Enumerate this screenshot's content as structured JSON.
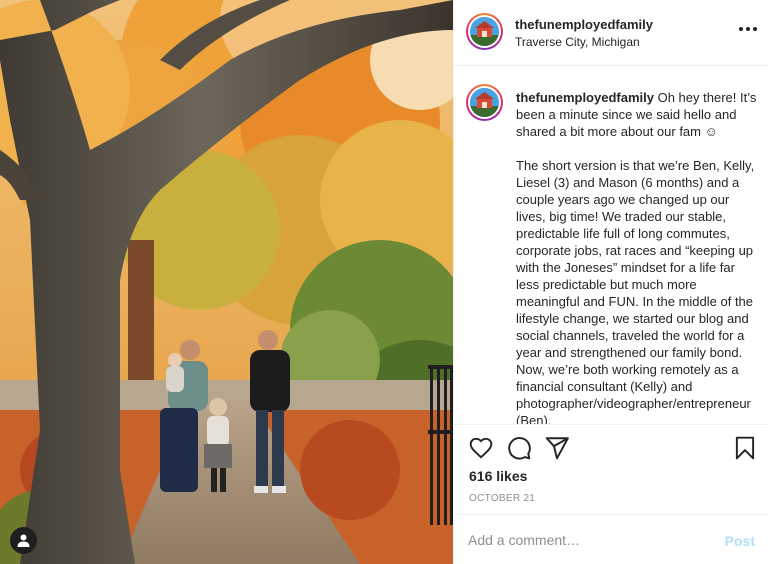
{
  "post": {
    "username": "thefunemployedfamily",
    "location": "Traverse City, Michigan",
    "caption_paragraphs": [
      "Oh hey there! It’s been a minute since we said hello and shared a bit more about our fam ☺",
      "The short version is that we’re Ben, Kelly, Liesel (3) and Mason (6 months) and a couple years ago we changed up our lives, big time! We traded our stable, predictable life full of long commutes, corporate jobs, rat races and “keeping up with the Joneses” mindset for a life far less predictable but much more meaningful and FUN. In the middle of the lifestyle change, we started our blog and social channels, traveled the world for a year and strengthened our family bond. Now, we’re both working remotely as a financial consultant (Kelly) and photographer/videographer/entrepreneur (Ben)."
    ],
    "likes": "616 likes",
    "date": "OCTOBER 21"
  },
  "comment_box": {
    "placeholder": "Add a comment…",
    "post_label": "Post"
  },
  "icons": {
    "more": "more-options-icon",
    "like": "heart-icon",
    "comment": "comment-bubble-icon",
    "share": "paper-plane-icon",
    "save": "bookmark-icon",
    "tags": "user-tag-icon"
  },
  "colors": {
    "story_ring": [
      "#f58529",
      "#dd2a7b",
      "#8134af"
    ],
    "post_button_disabled": "#b2dffc",
    "secondary_text": "#8e8e8e"
  }
}
